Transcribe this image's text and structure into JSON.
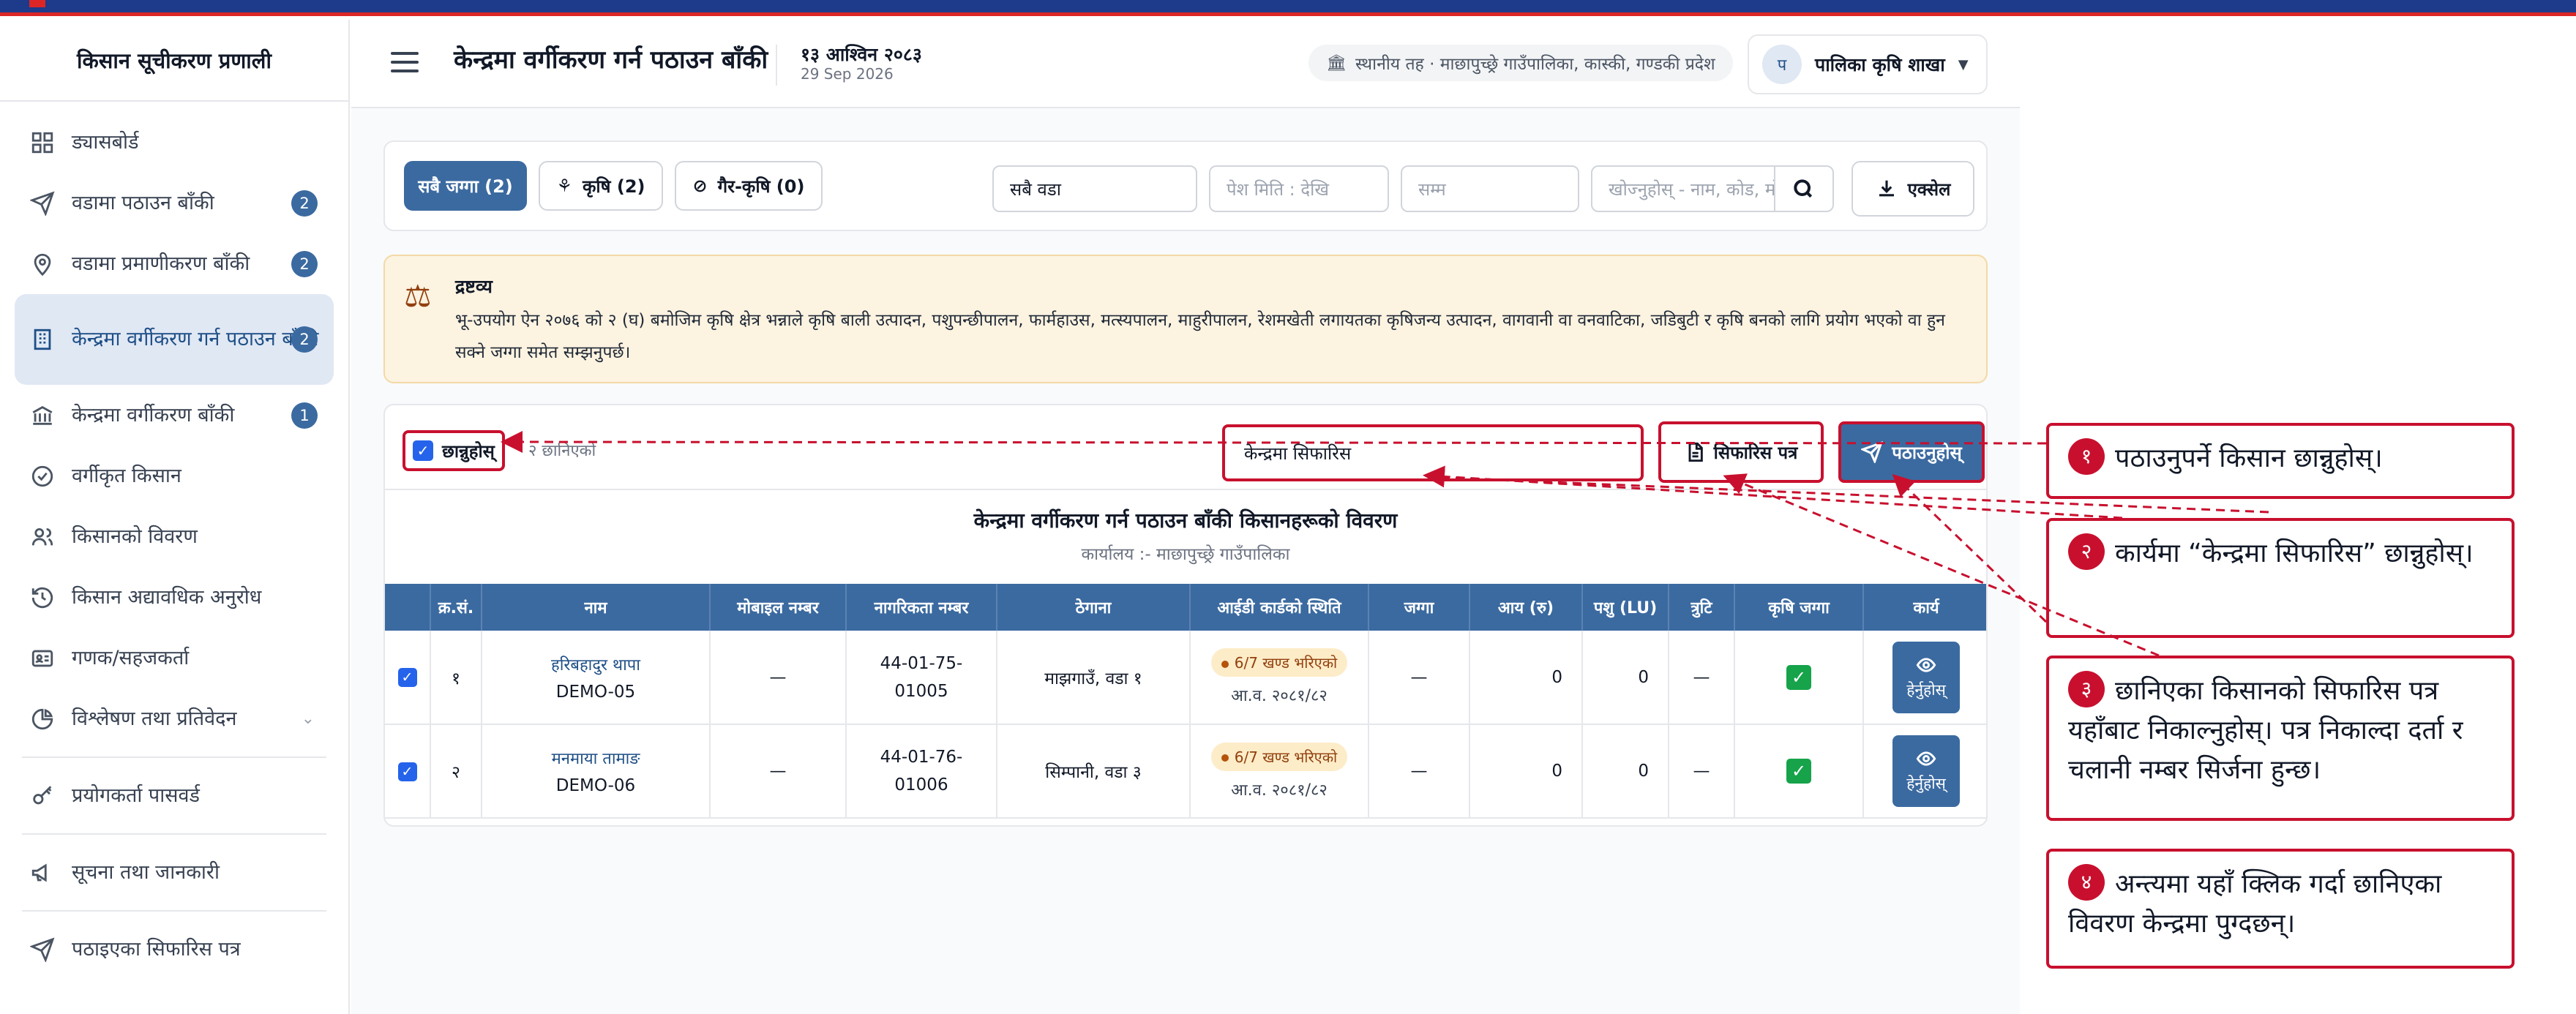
{
  "brand": "किसान सूचीकरण प्रणाली",
  "sidebar": {
    "items": [
      {
        "label": "ड्यासबोर्ड",
        "icon": "dashboard-icon"
      },
      {
        "label": "वडामा पठाउन बाँकी",
        "badge": "2",
        "icon": "send-icon"
      },
      {
        "label": "वडामा प्रमाणीकरण बाँकी",
        "badge": "2",
        "icon": "location-pin-icon"
      },
      {
        "label": "केन्द्रमा वर्गीकरण गर्न पठाउन बाँकी",
        "badge": "2",
        "icon": "building-icon"
      },
      {
        "label": "केन्द्रमा वर्गीकरण बाँकी",
        "badge": "1",
        "icon": "bank-icon"
      },
      {
        "label": "वर्गीकृत किसान",
        "icon": "check-circle-icon"
      },
      {
        "label": "किसानको विवरण",
        "icon": "users-icon"
      },
      {
        "label": "किसान अद्यावधिक अनुरोध",
        "icon": "history-icon"
      },
      {
        "label": "गणक/सहजकर्ता",
        "icon": "id-card-icon"
      },
      {
        "label": "विश्लेषण तथा प्रतिवेदन",
        "icon": "pie-chart-icon"
      },
      {
        "label": "प्रयोगकर्ता पासवर्ड",
        "icon": "key-icon"
      },
      {
        "label": "सूचना तथा जानकारी",
        "icon": "megaphone-icon"
      },
      {
        "label": "पठाइएका सिफारिस पत्र",
        "icon": "send-icon"
      }
    ]
  },
  "header": {
    "title": "केन्द्रमा वर्गीकरण गर्न पठाउन बाँकी",
    "date_np": "१३ आश्विन २०८३",
    "date_en": "29 Sep 2026",
    "location": "स्थानीय तह · माछापुच्छ्रे गाउँपालिका, कास्की, गण्डकी प्रदेश",
    "user_initial": "प",
    "user_name": "पालिका कृषि शाखा"
  },
  "filters": {
    "tabs": [
      "सबै जग्गा (2)",
      "कृषि (2)",
      "गैर-कृषि (0)"
    ],
    "ward_value": "सबै वडा",
    "date_placeholder": "पेश मिति : देखि",
    "to_placeholder": "सम्म",
    "search_placeholder": "खोज्नुहोस् - नाम, कोड, मो",
    "excel_label": "एक्सेल"
  },
  "notice": {
    "title": "द्रष्टव्य",
    "body": "भू-उपयोग ऐन २०७६ को २ (घ) बमोजिम कृषि क्षेत्र भन्नाले कृषि बाली उत्पादन, पशुपन्छीपालन, फार्महाउस, मत्स्यपालन, माहुरीपालन, रेशमखेती लगायतका कृषिजन्य उत्पादन, वागवानी वा वनवाटिका, जडिबुटी र कृषि बनको लागि प्रयोग भएको वा हुन सक्ने जग्गा समेत सम्झनुपर्छ।"
  },
  "actions": {
    "select_all": "छान्नुहोस्",
    "selected_text": "२ छानिएको",
    "destination": "केन्द्रमा सिफारिस",
    "letter_label": "सिफारिस पत्र",
    "send_label": "पठाउनुहोस्"
  },
  "report": {
    "title": "केन्द्रमा वर्गीकरण गर्न पठाउन बाँकी किसानहरूको विवरण",
    "subtitle": "कार्यालय :- माछापुच्छ्रे गाउँपालिका"
  },
  "table": {
    "columns": [
      "क्र.सं.",
      "नाम",
      "मोबाइल नम्बर",
      "नागरिकता नम्बर",
      "ठेगाना",
      "आईडी कार्डको स्थिति",
      "जग्गा",
      "आय (रु)",
      "पशु (LU)",
      "त्रुटि",
      "कृषि जग्गा",
      "कार्य"
    ],
    "rows": [
      {
        "sn": "१",
        "name": "हरिबहादुर थापा",
        "code": "DEMO-05",
        "mobile": "—",
        "citizenship": "44-01-75-01005",
        "address": "माझगाउँ, वडा १",
        "status": "6/7 खण्ड भरिएको",
        "status_date": "आ.व. २०८१/८२",
        "land": "—",
        "income": "0",
        "livestock": "0",
        "error": "—",
        "view": "हेर्नुहोस्"
      },
      {
        "sn": "२",
        "name": "मनमाया तामाङ",
        "code": "DEMO-06",
        "mobile": "—",
        "citizenship": "44-01-76-01006",
        "address": "सिम्पानी, वडा ३",
        "status": "6/7 खण्ड भरिएको",
        "status_date": "आ.व. २०८१/८२",
        "land": "—",
        "income": "0",
        "livestock": "0",
        "error": "—",
        "view": "हेर्नुहोस्"
      }
    ]
  },
  "callouts": [
    {
      "num": "१",
      "text": "पठाउनुपर्ने किसान छान्नुहोस्।"
    },
    {
      "num": "२",
      "text": "कार्यमा “केन्द्रमा सिफारिस” छान्नुहोस्।"
    },
    {
      "num": "३",
      "text": "छानिएका किसानको सिफारिस पत्र यहाँबाट निकाल्नुहोस्। पत्र निकाल्दा दर्ता र चलानी नम्बर सिर्जना हुन्छ।"
    },
    {
      "num": "४",
      "text": "अन्त्यमा यहाँ क्लिक गर्दा छानिएका विवरण केन्द्रमा पुग्दछन्।"
    }
  ],
  "colors": {
    "primary": "#3b6aa0",
    "highlight": "#c8102e",
    "notice_bg": "#fdf3e1"
  }
}
